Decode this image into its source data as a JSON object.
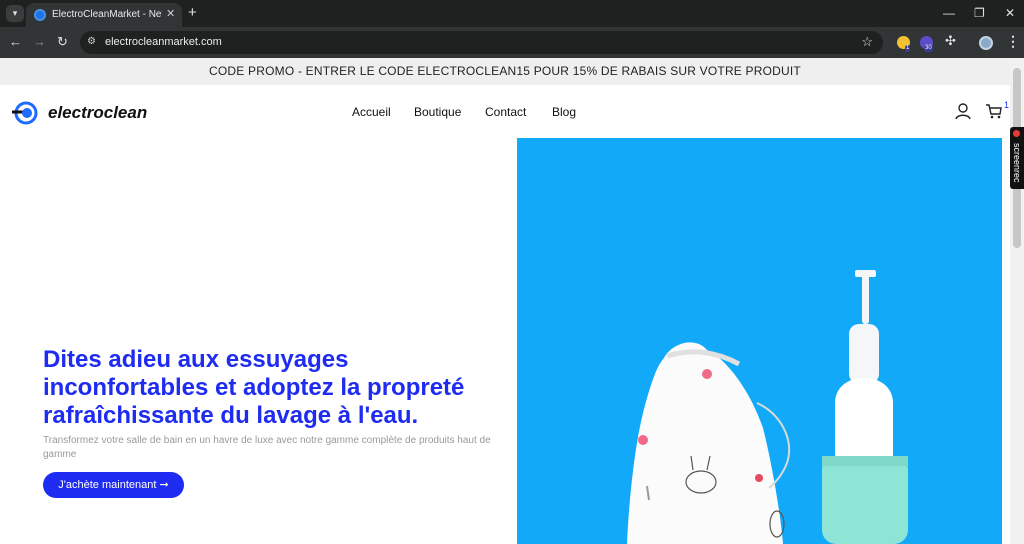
{
  "browser": {
    "tab_title": "ElectroCleanMarket - Nettoyage",
    "tab_close": "✕",
    "new_tab": "+",
    "url": "electrocleanmarket.com",
    "extension_badges": [
      "1",
      "30"
    ],
    "controls": {
      "back": "←",
      "forward": "→",
      "reload": "↻",
      "minimize": "—",
      "maximize": "❐",
      "close": "✕",
      "menu": "⋮",
      "bookmark": "☆",
      "tab_menu": "▾"
    }
  },
  "screenrec": {
    "label": "screenrec"
  },
  "promo": {
    "text": "CODE PROMO - ENTRER LE CODE ELECTROCLEAN15 POUR 15% DE RABAIS SUR VOTRE PRODUIT"
  },
  "header": {
    "logo_text": "electroclean",
    "nav": [
      "Accueil",
      "Boutique",
      "Contact",
      "Blog"
    ],
    "cart_count": "1"
  },
  "hero": {
    "title": "Dites adieu aux essuyages inconfortables et adoptez la propreté rafraîchissante du lavage à l'eau.",
    "subtitle": "Transformez votre salle de bain en un havre de luxe avec notre gamme complète de produits haut de gamme",
    "cta_label": "J'achète maintenant ➞"
  },
  "colors": {
    "accent": "#1e2bf0",
    "hero_bg": "#12a9f9",
    "device_mint": "#8ee5d6"
  }
}
